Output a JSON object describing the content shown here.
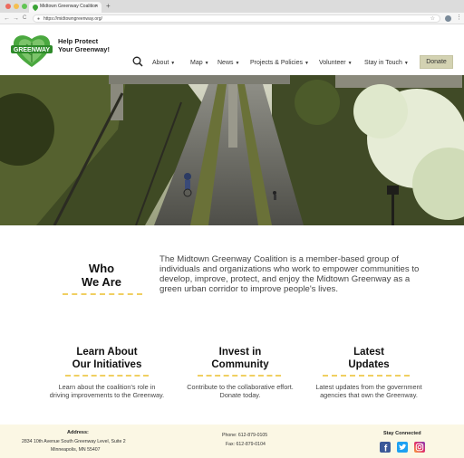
{
  "browser": {
    "tab_title": "Midtown Greenway Coalition",
    "tab_close": "×",
    "new_tab": "+",
    "url": "https://midtowngreenway.org/",
    "back": "←",
    "forward": "→",
    "reload": "C"
  },
  "header": {
    "logo_text": "GREENWAY",
    "tagline_line1": "Help Protect",
    "tagline_line2": "Your Greenway!",
    "menu": [
      {
        "label": "About"
      },
      {
        "label": "Map"
      },
      {
        "label": "News"
      },
      {
        "label": "Projects & Policies"
      },
      {
        "label": "Volunteer"
      },
      {
        "label": "Stay in Touch"
      }
    ],
    "donate_label": "Donate"
  },
  "who": {
    "title_line1": "Who",
    "title_line2": "We Are",
    "body": "The Midtown Greenway Coalition is a member-based group of individuals and organizations who work to empower communities to develop, improve, protect, and enjoy the Midtown Greenway as a green urban corridor to improve people's lives."
  },
  "columns": [
    {
      "title_line1": "Learn About",
      "title_line2": "Our Initiatives",
      "body": "Learn about the coalition's role in driving improvements to the Greenway."
    },
    {
      "title_line1": "Invest in",
      "title_line2": "Community",
      "body": "Contribute to the collaborative effort. Donate today."
    },
    {
      "title_line1": "Latest",
      "title_line2": "Updates",
      "body": "Latest updates from the government agencies that own the Greenway."
    }
  ],
  "footer": {
    "address_label": "Address:",
    "address_line1": "2834 10th Avenue South Greenway Level, Suite 2",
    "address_line2": "Minneapolis, MN 55407",
    "phone": "Phone: 612-879-0105",
    "fax": "Fax: 612-879-0104",
    "stay_connected": "Stay Connected",
    "social": [
      "facebook-icon",
      "twitter-icon",
      "instagram-icon"
    ]
  },
  "colors": {
    "brand_green": "#3aa335",
    "accent_dash": "#f0cf61",
    "donate_bg": "#d3d2b2",
    "footer_bg": "#fbf7e4"
  }
}
